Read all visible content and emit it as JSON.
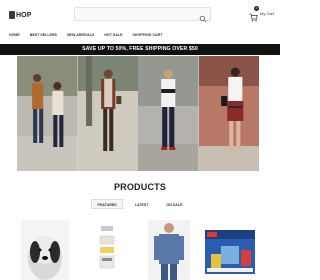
{
  "header": {
    "logo_text": "HOP",
    "search_placeholder": "",
    "cart_count": "0",
    "cart_label": "My Cart"
  },
  "nav": {
    "items": [
      "Home",
      "Best Sellers",
      "New Arrivals",
      "Hot Sale",
      "Shopping Cart"
    ]
  },
  "promo": {
    "text": "SAVE UP TO 50%, FREE SHIPPING OVER $50"
  },
  "products": {
    "title": "PRODUCTS",
    "tabs": [
      "Featured",
      "Latest",
      "On Sale"
    ],
    "active_tab": "Featured"
  },
  "colors": {
    "promo_bg": "#121212",
    "text": "#222222"
  }
}
